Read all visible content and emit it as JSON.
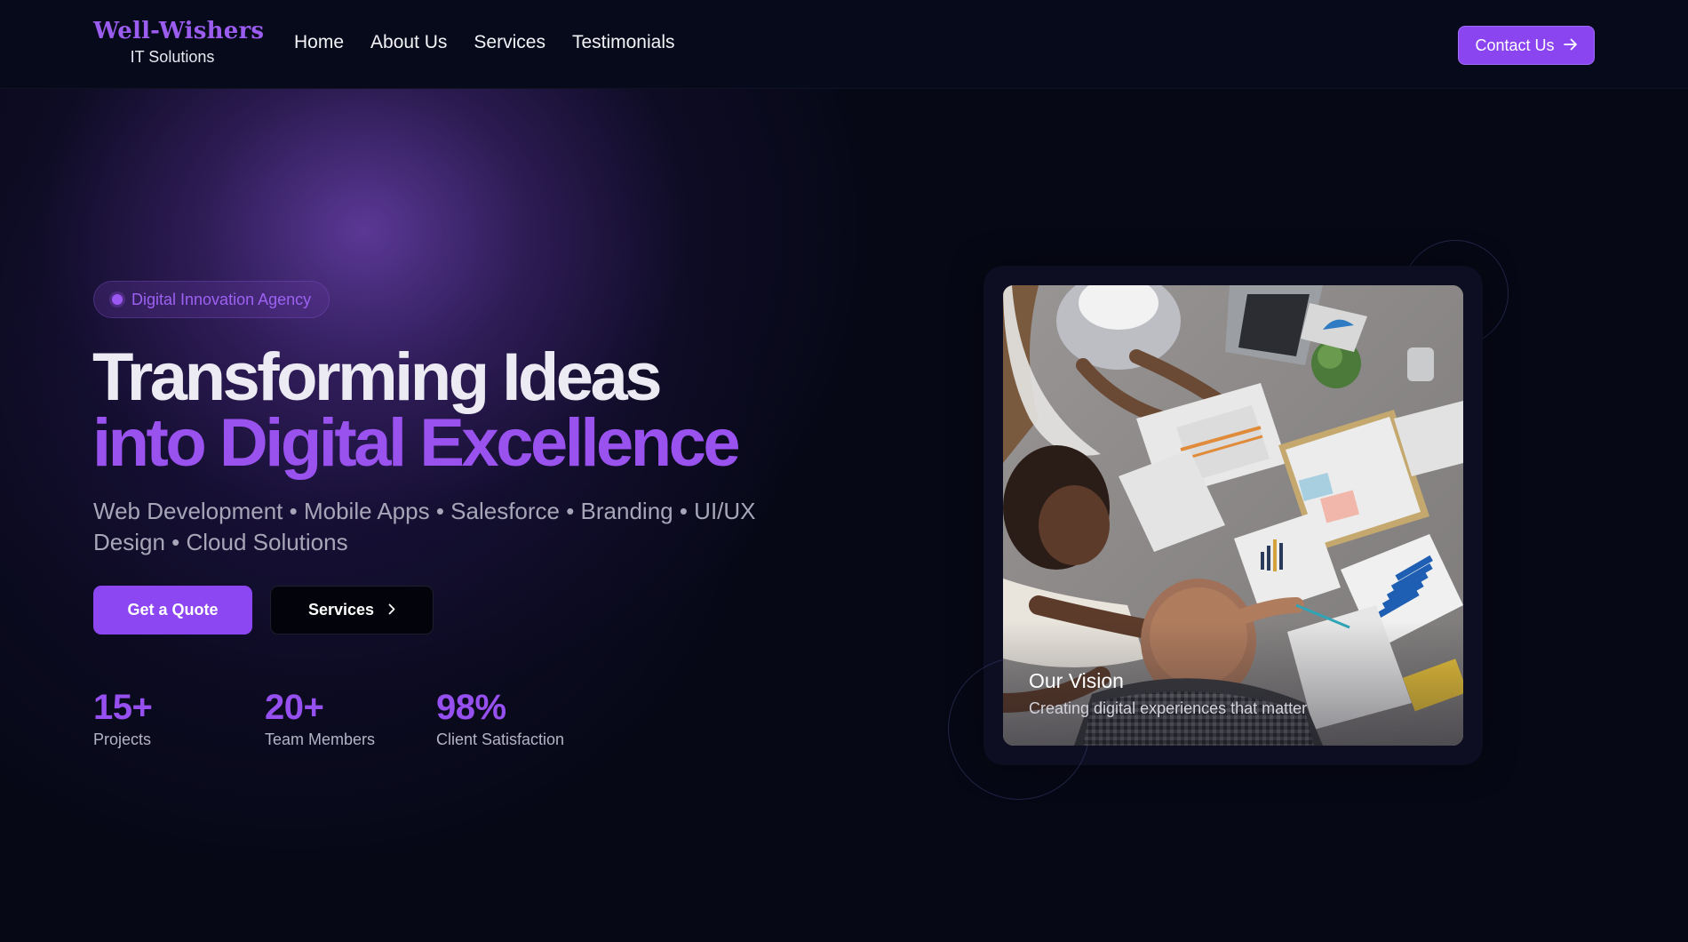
{
  "nav": {
    "logo_title": "Well-Wishers",
    "logo_subtitle": "IT Solutions",
    "links": [
      "Home",
      "About Us",
      "Services",
      "Testimonials"
    ],
    "contact_label": "Contact Us"
  },
  "hero": {
    "badge": "Digital Innovation Agency",
    "title_line1": "Transforming Ideas",
    "title_line2": "into Digital Excellence",
    "subtitle": "Web Development • Mobile Apps • Salesforce • Branding • UI/UX Design • Cloud Solutions",
    "primary_cta": "Get a Quote",
    "secondary_cta": "Services",
    "stats": [
      {
        "value": "15+",
        "label": "Projects"
      },
      {
        "value": "20+",
        "label": "Team Members"
      },
      {
        "value": "98%",
        "label": "Client Satisfaction"
      }
    ]
  },
  "vision_card": {
    "title": "Our Vision",
    "description": "Creating digital experiences that matter"
  },
  "colors": {
    "accent": "#8d47f2",
    "accent_text": "#9a52ef",
    "background": "#060815"
  },
  "icons": {
    "contact_arrow": "arrow-right-icon",
    "services_chevron": "chevron-right-icon",
    "badge_dot": "dot-icon"
  }
}
